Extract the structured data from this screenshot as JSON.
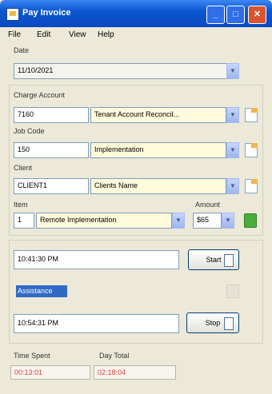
{
  "window": {
    "title": "Pay Invoice"
  },
  "menu": {
    "items": [
      "File",
      "Edit",
      "View",
      "Help"
    ]
  },
  "date": {
    "label": "Date",
    "value": "11/10/2021"
  },
  "charge_account": {
    "label": "Charge Account",
    "code": "7160",
    "name": "Tenant Account Reconcil..."
  },
  "job_code": {
    "label": "Job Code",
    "code": "150",
    "name": "Implementation"
  },
  "client": {
    "label": "Client",
    "code": "CLIENT1",
    "name": "Clients Name"
  },
  "item": {
    "label": "Item",
    "code": "1",
    "name": "Remote Implementation"
  },
  "amount": {
    "label": "Amount",
    "value": "$65"
  },
  "start_time": {
    "value": "10:41:30 PM",
    "button_label": "Start"
  },
  "description": {
    "value": "Assistance"
  },
  "end_time": {
    "value": "10:54:31 PM",
    "button_label": "Stop"
  },
  "time_spent": {
    "label": "Time Spent",
    "value": "00:13:01"
  },
  "day_total": {
    "label": "Day Total",
    "value": "02:18:04"
  },
  "colors": {
    "titlebar": "#0b57d0",
    "accent": "#316ac5",
    "total_text": "#e04040"
  }
}
